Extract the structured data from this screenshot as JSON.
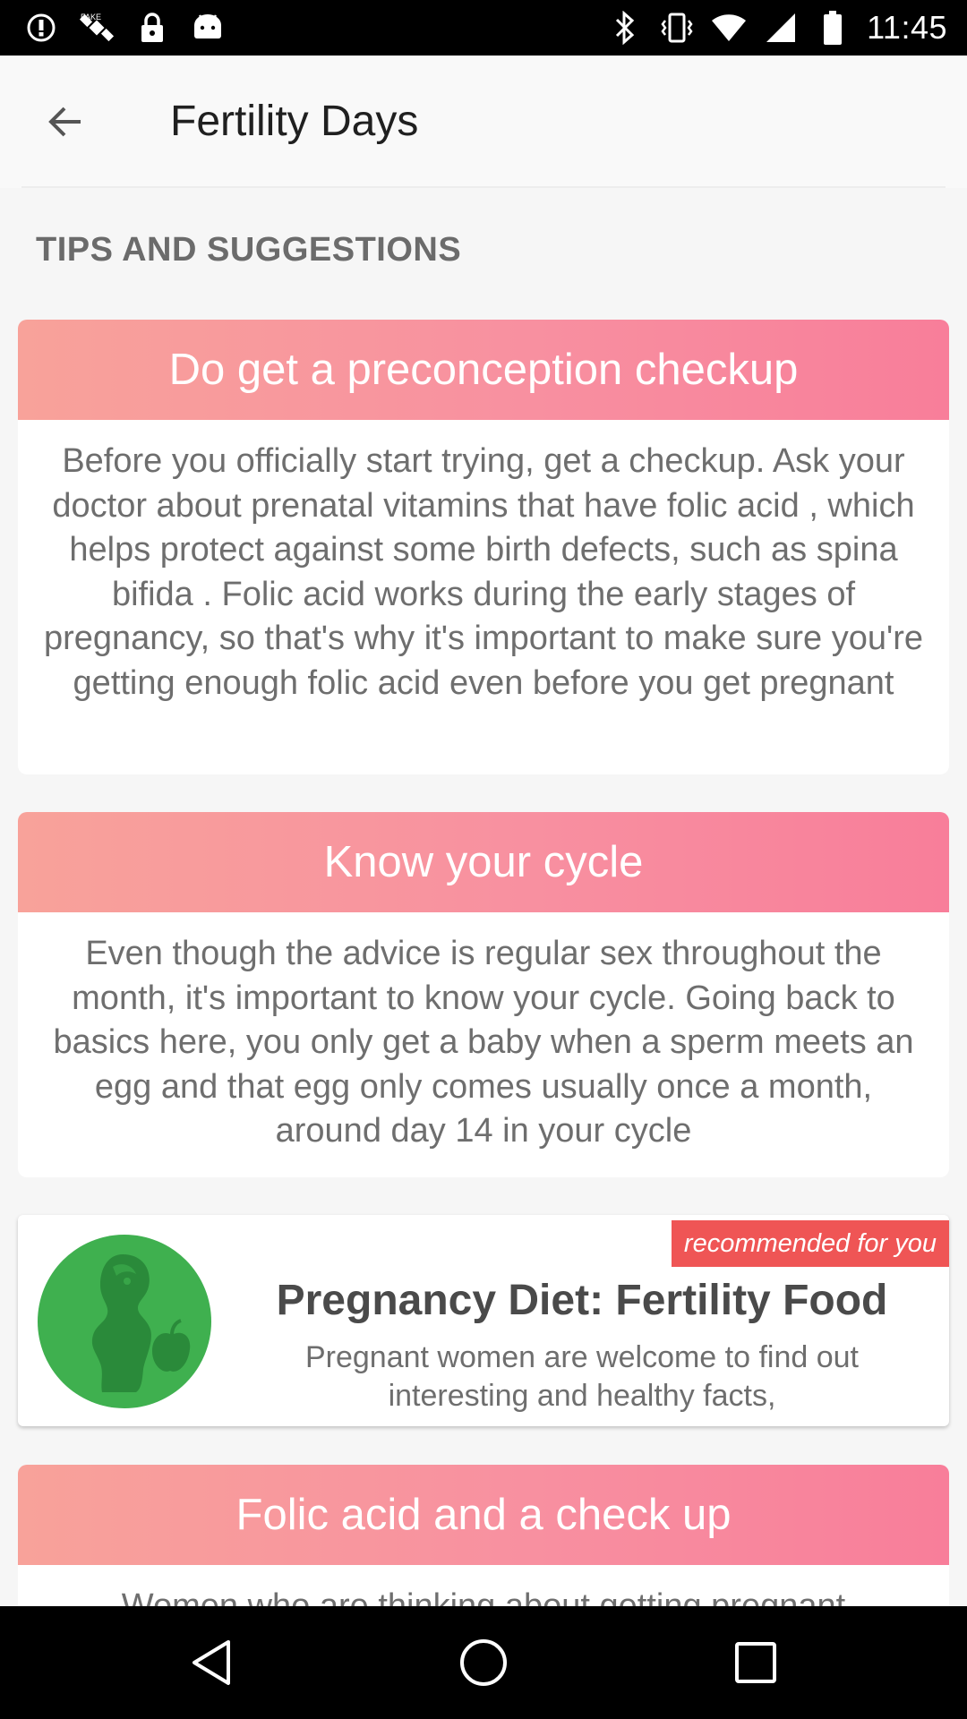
{
  "status_bar": {
    "time": "11:45",
    "left_icons": [
      "alert-circle-icon",
      "satellite-icon",
      "lock-icon",
      "android-icon"
    ],
    "right_icons": [
      "bluetooth-icon",
      "vibrate-icon",
      "wifi-icon",
      "signal-icon",
      "battery-icon"
    ]
  },
  "app_bar": {
    "title": "Fertility Days",
    "back_icon": "arrow-left-icon"
  },
  "section": {
    "heading": "TIPS AND SUGGESTIONS"
  },
  "tips": [
    {
      "title": "Do get a preconception checkup",
      "body": "Before you officially start trying, get a checkup. Ask your doctor about prenatal vitamins that have folic acid , which helps protect against some birth defects, such as spina bifida . Folic acid works during the early stages of pregnancy, so that's why it's important to make sure you're getting enough folic acid even before you get pregnant"
    },
    {
      "title": "Know your cycle",
      "body": "Even though the advice is regular sex throughout the month, it's important to know your cycle. Going back to basics here, you only get a baby when a sperm meets an egg and that egg only comes usually once a month, around day 14 in your cycle"
    },
    {
      "title": "Folic acid and a check up",
      "body": "Women who are thinking about getting pregnant"
    }
  ],
  "recommendation": {
    "badge": "recommended for you",
    "title": "Pregnancy Diet: Fertility Food",
    "description": "Pregnant women are welcome to find out interesting and healthy facts,",
    "logo_icon": "pregnant-woman-apple-icon",
    "colors": {
      "badge": "#ef5555",
      "logo_bg": "#3fb04f",
      "logo_fg": "#2a8a3a"
    }
  },
  "colors": {
    "header_gradient_start": "#f8a29a",
    "header_gradient_end": "#f87e9a"
  },
  "nav_bar": {
    "buttons": [
      "back-triangle-icon",
      "home-circle-icon",
      "recents-square-icon"
    ]
  }
}
